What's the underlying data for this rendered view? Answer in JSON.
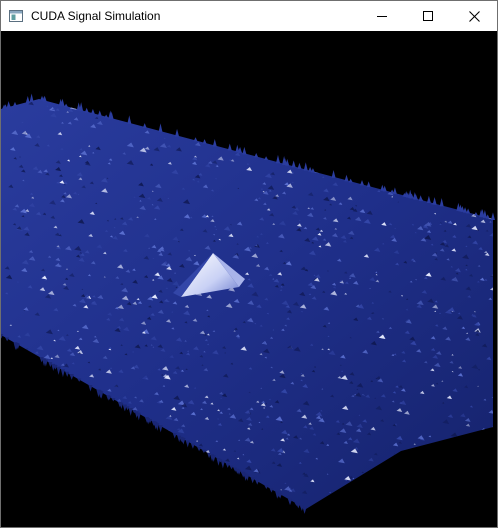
{
  "window": {
    "title": "CUDA Signal Simulation",
    "icon": "app-window-icon"
  },
  "caption_buttons": {
    "minimize_icon": "minimize-icon",
    "maximize_icon": "maximize-icon",
    "close_icon": "close-icon"
  },
  "scene": {
    "background_color": "#000000",
    "surface_color": "#1e2f8c",
    "highlight_color": "#e8ecff",
    "peak_color": "#f4f6ff"
  }
}
